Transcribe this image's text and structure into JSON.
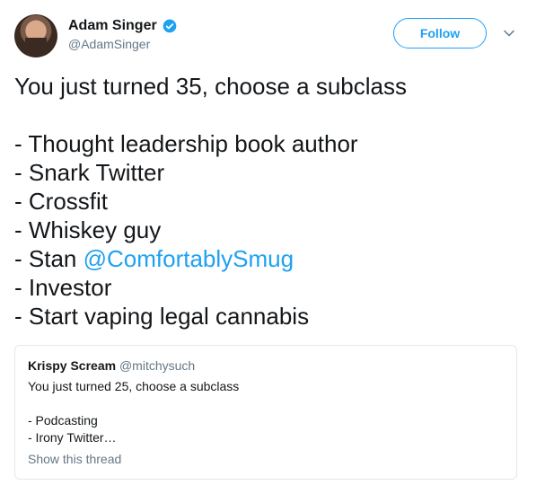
{
  "author": {
    "name": "Adam Singer",
    "handle": "@AdamSinger",
    "verified": true,
    "avatar_icon": "avatar-photo"
  },
  "follow_label": "Follow",
  "tweet": {
    "line1": "You just turned 35, choose a subclass",
    "items": [
      "- Thought leadership book author",
      "- Snark Twitter",
      "- Crossfit",
      "- Whiskey guy",
      "- Stan ",
      "- Investor",
      "- Start vaping legal cannabis"
    ],
    "mention": "@ComfortablySmug"
  },
  "quoted": {
    "name": "Krispy Scream",
    "handle": "@mitchysuch",
    "line1": "You just turned 25, choose a subclass",
    "items": [
      "- Podcasting",
      "- Irony Twitter…"
    ],
    "show_thread": "Show this thread"
  },
  "colors": {
    "accent": "#1da1f2",
    "text": "#14171a",
    "secondary": "#657786",
    "border": "#e1e8ed"
  }
}
